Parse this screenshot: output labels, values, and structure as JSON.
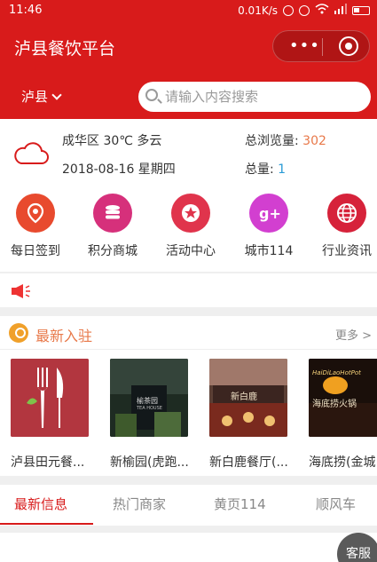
{
  "status_bar": {
    "time": "11:46",
    "net_speed": "0.01K/s"
  },
  "header": {
    "title": "泸县餐饮平台"
  },
  "location": {
    "city": "泸县"
  },
  "search": {
    "placeholder": "请输入内容搜索"
  },
  "weather": {
    "location_weather": "成华区 30℃ 多云",
    "date": "2018-08-16 星期四",
    "total_views_label": "总浏览量:",
    "total_views": "302",
    "total_label": "总量:",
    "total": "1"
  },
  "menu": [
    {
      "label": "每日签到",
      "icon": "location-pin-icon",
      "color": "#e84a2e"
    },
    {
      "label": "积分商城",
      "icon": "coins-icon",
      "color": "#d6307b"
    },
    {
      "label": "活动中心",
      "icon": "star-icon",
      "color": "#e0344c"
    },
    {
      "label": "城市114",
      "icon": "google-plus-icon",
      "color": "#d23fd0"
    },
    {
      "label": "行业资讯",
      "icon": "globe-icon",
      "color": "#d6223a"
    }
  ],
  "new_section": {
    "title": "最新入驻",
    "more": "更多 >"
  },
  "shops": [
    {
      "name": "泸县田元餐..."
    },
    {
      "name": "新榆园(虎跑..."
    },
    {
      "name": "新白鹿餐厅(..."
    },
    {
      "name": "海底捞(金城"
    }
  ],
  "shop_image_text": {
    "tea_sign": "榆茶园",
    "tea_sub": "TEA HOUSE",
    "bailu_sign": "新白鹿",
    "haidilao_en": "HaiDiLaoHotPot",
    "haidilao_cn": "海底捞火锅"
  },
  "tabs": [
    "最新信息",
    "热门商家",
    "黄页114",
    "顺风车"
  ],
  "customer_service": "客服"
}
